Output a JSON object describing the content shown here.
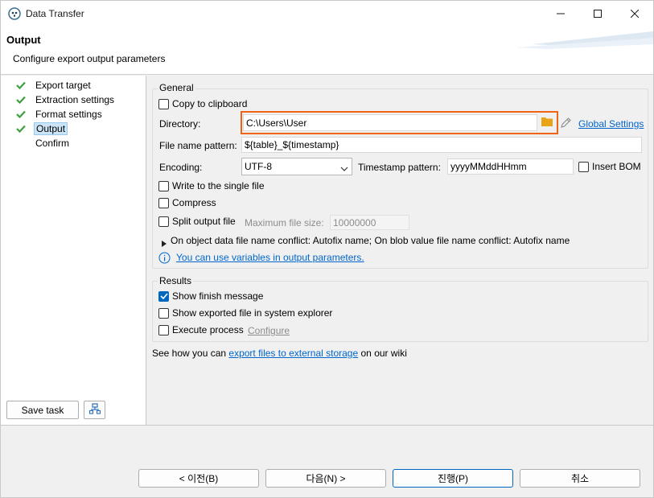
{
  "window": {
    "title": "Data Transfer"
  },
  "header": {
    "title": "Output",
    "description": "Configure export output parameters"
  },
  "nav": {
    "items": [
      {
        "label": "Export target",
        "done": true
      },
      {
        "label": "Extraction settings",
        "done": true
      },
      {
        "label": "Format settings",
        "done": true
      },
      {
        "label": "Output",
        "done": true,
        "selected": true
      },
      {
        "label": "Confirm",
        "done": false
      }
    ],
    "save_task_label": "Save task"
  },
  "general": {
    "title": "General",
    "copy_to_clipboard": {
      "label": "Copy to clipboard",
      "checked": false
    },
    "directory": {
      "label": "Directory:",
      "value": "C:\\Users\\User"
    },
    "global_settings_label": "Global Settings",
    "file_name_pattern": {
      "label": "File name pattern:",
      "value": "${table}_${timestamp}"
    },
    "encoding": {
      "label": "Encoding:",
      "value": "UTF-8"
    },
    "timestamp_pattern": {
      "label": "Timestamp pattern:",
      "value": "yyyyMMddHHmm"
    },
    "insert_bom": {
      "label": "Insert BOM",
      "checked": false
    },
    "write_single_file": {
      "label": "Write to the single file",
      "checked": false
    },
    "compress": {
      "label": "Compress",
      "checked": false
    },
    "split_output_file": {
      "label": "Split output file",
      "checked": false
    },
    "max_file_size": {
      "label": "Maximum file size:",
      "value": "10000000"
    },
    "conflict_text": "On object data file name conflict: Autofix name; On blob value file name conflict: Autofix name",
    "variables_link": "You can use variables in output parameters."
  },
  "results": {
    "title": "Results",
    "show_finish_message": {
      "label": "Show finish message",
      "checked": true
    },
    "show_exported_file": {
      "label": "Show exported file in system explorer",
      "checked": false
    },
    "execute_process": {
      "label": "Execute process",
      "checked": false
    },
    "configure_label": "Configure"
  },
  "wiki": {
    "prefix": "See how you can ",
    "link": "export files to external storage",
    "suffix": " on our wiki"
  },
  "buttons": {
    "back": "< 이전(B)",
    "next": "다음(N) >",
    "proceed": "진행(P)",
    "cancel": "취소"
  },
  "colors": {
    "accent": "#0067c0",
    "highlight_border": "#f06418",
    "check_green": "#3ca03c",
    "folder": "#e8a317",
    "link": "#0066cc"
  }
}
